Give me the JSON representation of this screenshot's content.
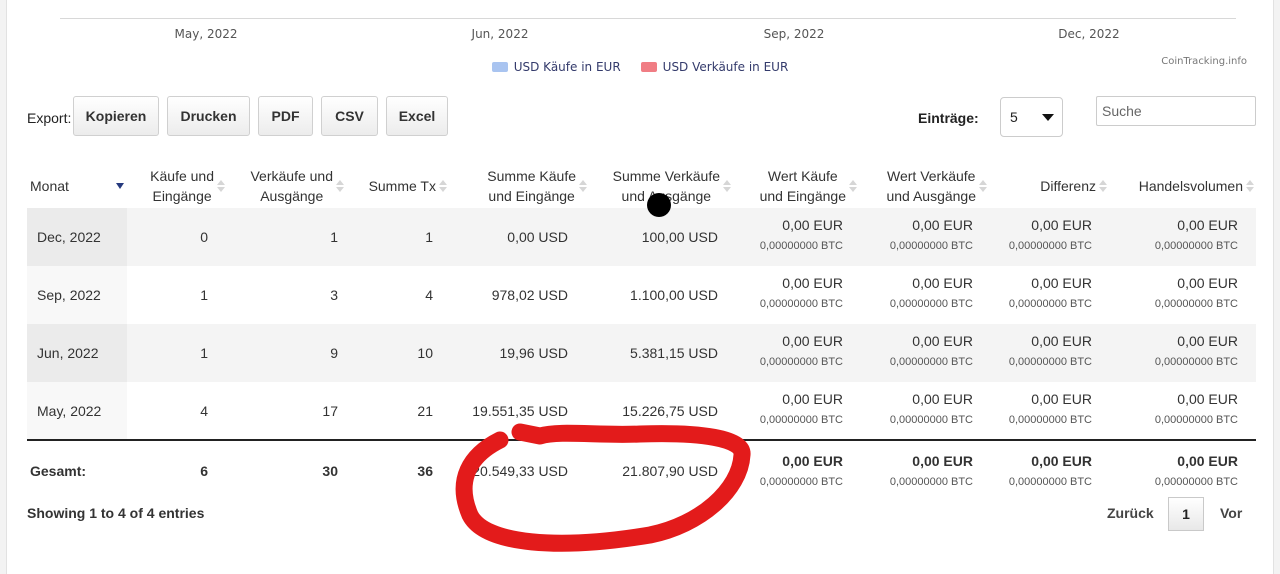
{
  "chart": {
    "x_ticks": [
      "May, 2022",
      "Jun, 2022",
      "Sep, 2022",
      "Dec, 2022"
    ],
    "legend": [
      {
        "label": "USD Käufe in EUR",
        "color": "#a9c4f0"
      },
      {
        "label": "USD Verkäufe in EUR",
        "color": "#f07d84"
      }
    ],
    "credit": "CoinTracking.info"
  },
  "toolbar": {
    "export_label": "Export:",
    "buttons": [
      "Kopieren",
      "Drucken",
      "PDF",
      "CSV",
      "Excel"
    ],
    "entries_label": "Einträge:",
    "entries_value": "5",
    "search_placeholder": "Suche"
  },
  "table": {
    "headers": {
      "monat": "Monat",
      "kaeufe": [
        "Käufe und",
        "Eingänge"
      ],
      "verkaeufe": [
        "Verkäufe und",
        "Ausgänge"
      ],
      "summe_tx": "Summe Tx",
      "summe_kaeufe": [
        "Summe Käufe",
        "und Eingänge"
      ],
      "summe_verkaeufe": [
        "Summe Verkäufe",
        "und Ausgänge"
      ],
      "wert_kaeufe": [
        "Wert Käufe",
        "und Eingänge"
      ],
      "wert_verkaeufe": [
        "Wert Verkäufe",
        "und Ausgänge"
      ],
      "differenz": "Differenz",
      "handelsvolumen": "Handelsvolumen"
    },
    "rows": [
      {
        "monat": "Dec, 2022",
        "kaeufe": "0",
        "verkaeufe": "1",
        "tx": "1",
        "summe_kaeufe": "0,00 USD",
        "summe_verkaeufe": "100,00 USD",
        "eur": "0,00 EUR",
        "btc": "0,00000000 BTC"
      },
      {
        "monat": "Sep, 2022",
        "kaeufe": "1",
        "verkaeufe": "3",
        "tx": "4",
        "summe_kaeufe": "978,02 USD",
        "summe_verkaeufe": "1.100,00 USD",
        "eur": "0,00 EUR",
        "btc": "0,00000000 BTC"
      },
      {
        "monat": "Jun, 2022",
        "kaeufe": "1",
        "verkaeufe": "9",
        "tx": "10",
        "summe_kaeufe": "19,96 USD",
        "summe_verkaeufe": "5.381,15 USD",
        "eur": "0,00 EUR",
        "btc": "0,00000000 BTC"
      },
      {
        "monat": "May, 2022",
        "kaeufe": "4",
        "verkaeufe": "17",
        "tx": "21",
        "summe_kaeufe": "19.551,35 USD",
        "summe_verkaeufe": "15.226,75 USD",
        "eur": "0,00 EUR",
        "btc": "0,00000000 BTC"
      }
    ],
    "footer": {
      "label": "Gesamt:",
      "kaeufe": "6",
      "verkaeufe": "30",
      "tx": "36",
      "summe_kaeufe": "20.549,33 USD",
      "summe_verkaeufe": "21.807,90 USD",
      "eur": "0,00 EUR",
      "btc": "0,00000000 BTC"
    }
  },
  "pagination": {
    "info": "Showing 1 to 4 of 4 entries",
    "prev": "Zurück",
    "page": "1",
    "next": "Vor"
  },
  "annotation": {
    "marker_color": "#e31b1b"
  }
}
